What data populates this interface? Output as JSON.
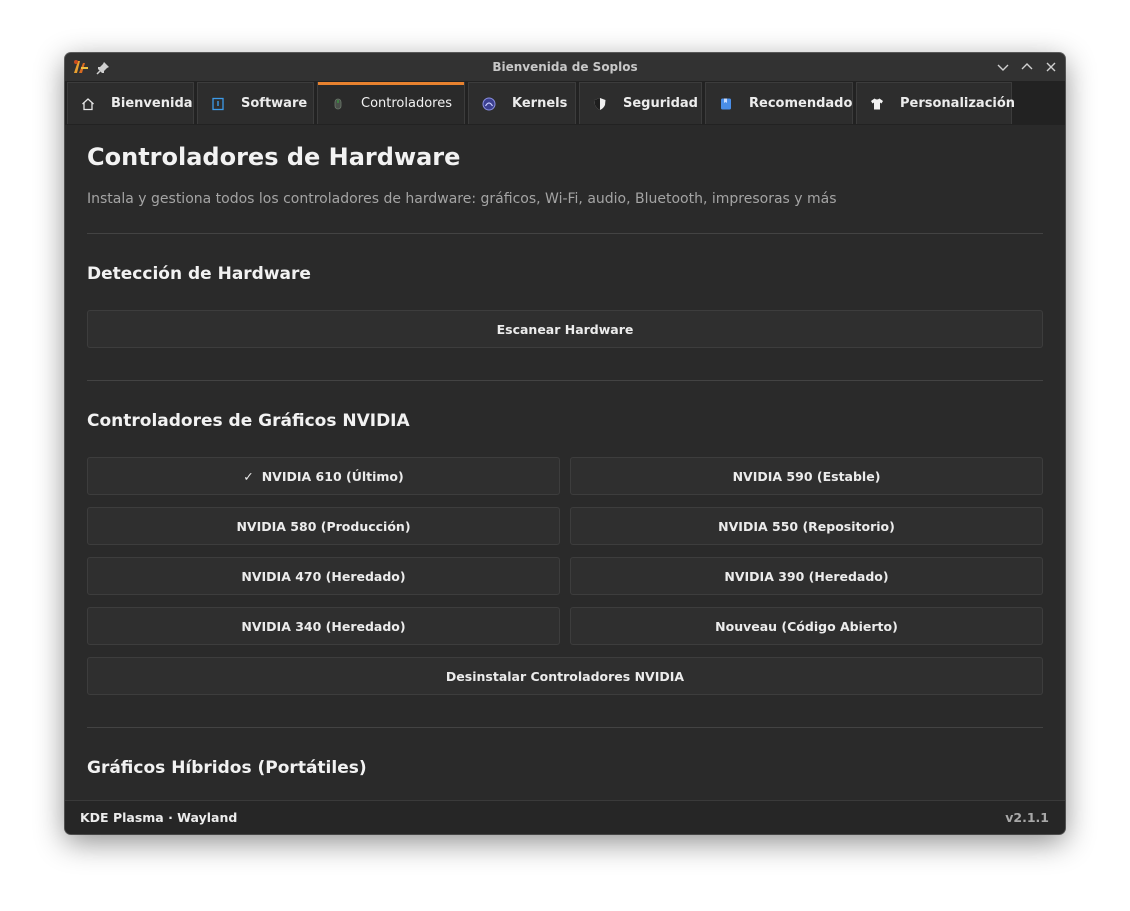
{
  "window": {
    "title": "Bienvenida de Soplos"
  },
  "tabs": [
    {
      "label": "Bienvenida",
      "icon": "home-icon"
    },
    {
      "label": "Software",
      "icon": "software-box-icon"
    },
    {
      "label": "Controladores",
      "icon": "mouse-icon",
      "active": true
    },
    {
      "label": "Kernels",
      "icon": "kernel-gauge-icon"
    },
    {
      "label": "Seguridad",
      "icon": "shield-icon"
    },
    {
      "label": "Recomendado",
      "icon": "bookmark-icon"
    },
    {
      "label": "Personalización",
      "icon": "tshirt-icon"
    }
  ],
  "page": {
    "title": "Controladores de Hardware",
    "subtitle": "Instala y gestiona todos los controladores de hardware: gráficos, Wi-Fi, audio, Bluetooth, impresoras y más"
  },
  "sections": {
    "detection": {
      "title": "Detección de Hardware",
      "scan_label": "Escanear Hardware"
    },
    "nvidia": {
      "title": "Controladores de Gráficos NVIDIA",
      "checkmark": "✓",
      "buttons": [
        "NVIDIA 610 (Último)",
        "NVIDIA 590 (Estable)",
        "NVIDIA 580 (Producción)",
        "NVIDIA 550 (Repositorio)",
        "NVIDIA 470 (Heredado)",
        "NVIDIA 390 (Heredado)",
        "NVIDIA 340 (Heredado)",
        "Nouveau (Código Abierto)"
      ],
      "uninstall_label": "Desinstalar Controladores NVIDIA"
    },
    "hybrid": {
      "title": "Gráficos Híbridos (Portátiles)"
    }
  },
  "statusbar": {
    "environment": "KDE Plasma · Wayland",
    "version": "v2.1.1"
  },
  "colors": {
    "accent": "#e8822f",
    "background": "#2a2a2a"
  }
}
